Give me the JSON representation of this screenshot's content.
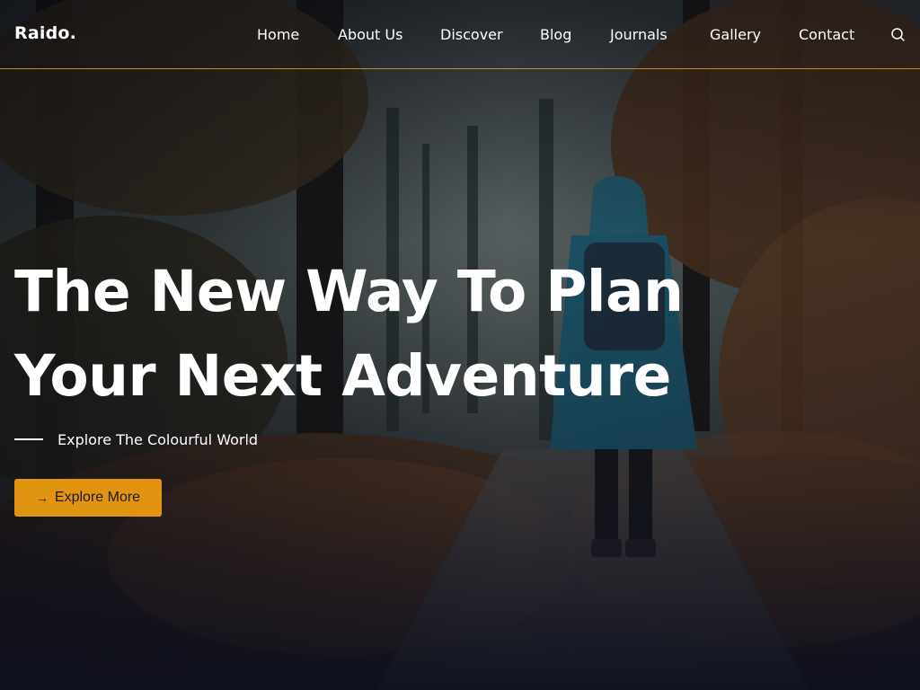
{
  "brand": {
    "logo": "Raido.",
    "accent": "#e0940f",
    "header_border": "#c98a2a"
  },
  "nav": {
    "items": [
      {
        "label": "Home"
      },
      {
        "label": "About Us"
      },
      {
        "label": "Discover"
      },
      {
        "label": "Blog"
      },
      {
        "label": "Journals"
      },
      {
        "label": "Gallery"
      },
      {
        "label": "Contact"
      }
    ],
    "search_icon": "search-icon"
  },
  "hero": {
    "headline_line1": "The New Way To Plan",
    "headline_line2": "Your Next Adventure",
    "subheading": "Explore The Colourful World",
    "cta_label": "Explore More",
    "cta_icon": "arrow-right-icon",
    "background": "forest-hiker-photo"
  }
}
